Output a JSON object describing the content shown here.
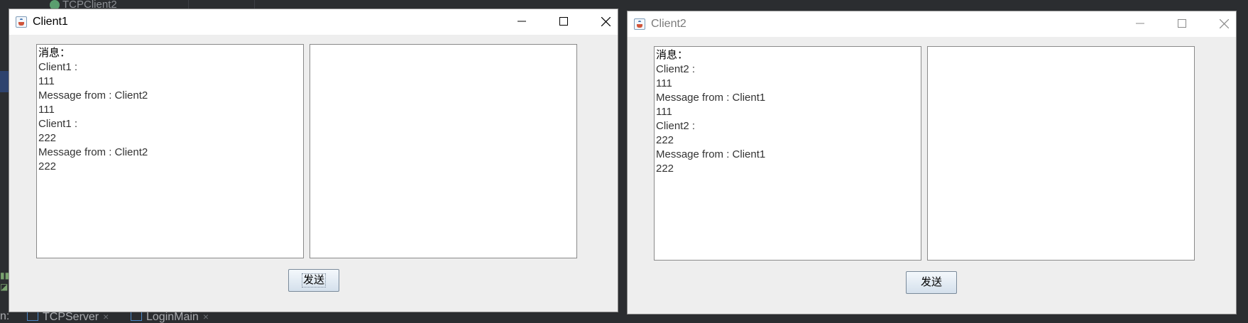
{
  "ide": {
    "tab_fragment": "TCPClient2",
    "run_label": "n:",
    "run_tabs": [
      {
        "label": "TCPServer",
        "close": "×"
      },
      {
        "label": "LoginMain",
        "close": "×"
      }
    ]
  },
  "client1": {
    "title": "Client1",
    "chat_lines": [
      "消息：",
      "Client1 :",
      "111",
      "Message from : Client2",
      "111",
      "Client1 :",
      "222",
      "Message from : Client2",
      "222"
    ],
    "input_value": "",
    "send_label": "发送"
  },
  "client2": {
    "title": "Client2",
    "chat_lines": [
      "消息：",
      "Client2 :",
      "111",
      "Message from : Client1",
      "111",
      "Client2 :",
      "222",
      "Message from : Client1",
      "222"
    ],
    "input_value": "",
    "send_label": "发送"
  },
  "colors": {
    "window_bg": "#eeeeee",
    "titlebar_bg": "#ffffff",
    "ide_bg": "#2b2d30",
    "button_gradient_top": "#f4f8fc",
    "button_gradient_bottom": "#d4e0ec"
  },
  "icons": {
    "app": "java-cup-icon",
    "minimize": "minimize-icon",
    "maximize": "maximize-icon",
    "close": "close-icon"
  }
}
